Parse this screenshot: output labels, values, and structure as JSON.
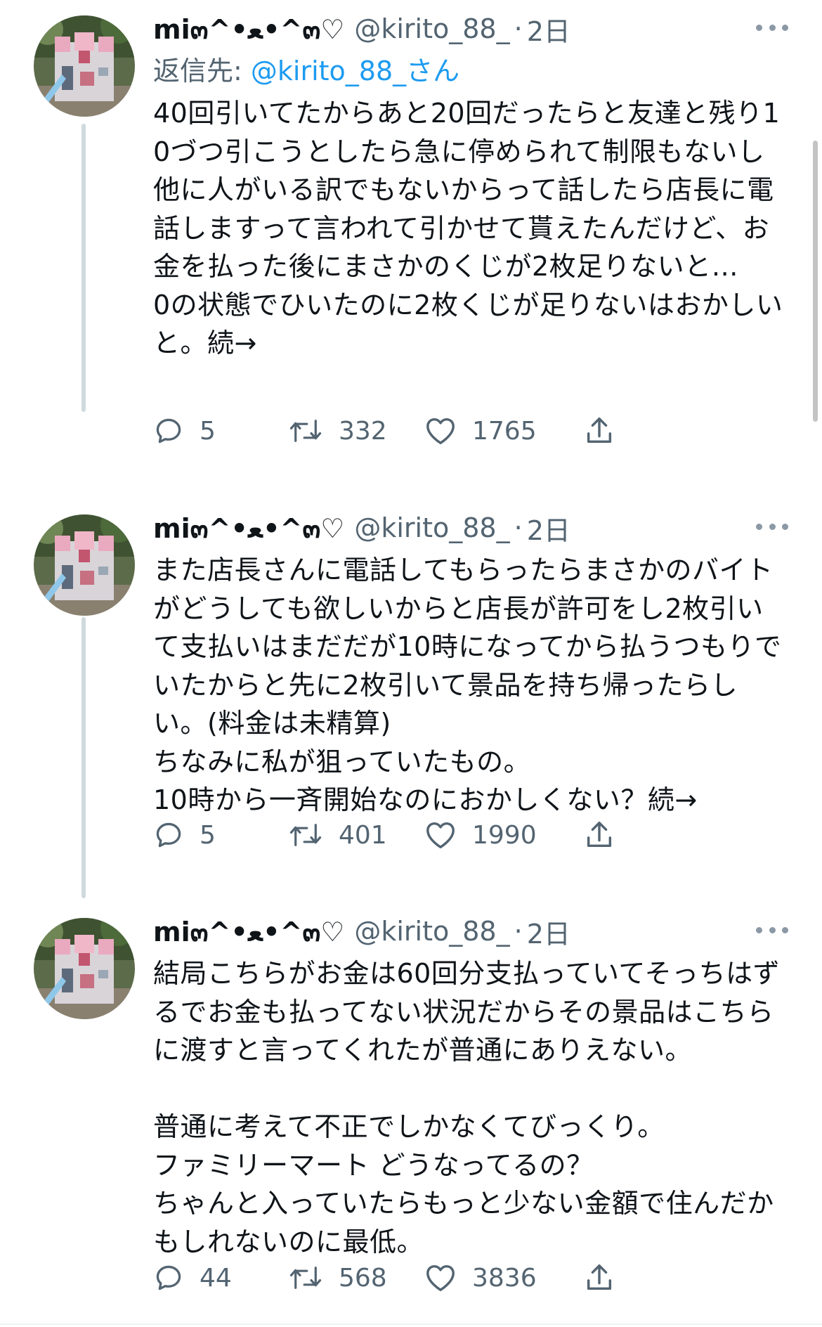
{
  "tweets": [
    {
      "display_name": "mi๓^•ﻌ•^๓♡",
      "handle": "@kirito_88_",
      "separator": "·",
      "time": "2日",
      "reply_to_prefix": "返信先: ",
      "reply_to_handle": "@kirito_88_さん",
      "text": "40回引いてたからあと20回だったらと友達と残り10づつ引こうとしたら急に停められて制限もないし他に人がいる訳でもないからって話したら店長に電話しますって言われて引かせて貰えたんだけど、お金を払った後にまさかのくじが2枚足りないと…\n0の状態でひいたのに2枚くじが足りないはおかしいと。続→",
      "replies": "5",
      "retweets": "332",
      "likes": "1765"
    },
    {
      "display_name": "mi๓^•ﻌ•^๓♡",
      "handle": "@kirito_88_",
      "separator": "·",
      "time": "2日",
      "text": "また店長さんに電話してもらったらまさかのバイトがどうしても欲しいからと店長が許可をし2枚引いて支払いはまだだが10時になってから払うつもりでいたからと先に2枚引いて景品を持ち帰ったらしい。(料金は未精算)\nちなみに私が狙っていたもの。\n10時から一斉開始なのにおかしくない？続→",
      "replies": "5",
      "retweets": "401",
      "likes": "1990"
    },
    {
      "display_name": "mi๓^•ﻌ•^๓♡",
      "handle": "@kirito_88_",
      "separator": "·",
      "time": "2日",
      "text": "結局こちらがお金は60回分支払っていてそっちはずるでお金も払ってない状況だからその景品はこちらに渡すと言ってくれたが普通にありえない。\n\n普通に考えて不正でしかなくてびっくり。\nファミリーマート どうなってるの？\nちゃんと入っていたらもっと少ない金額で住んだかもしれないのに最低。",
      "replies": "44",
      "retweets": "568",
      "likes": "3836"
    }
  ],
  "icons": {
    "avatar": "castle-photo-avatar",
    "reply": "reply-icon",
    "retweet": "retweet-icon",
    "like": "heart-icon",
    "share": "share-icon",
    "more": "more-icon"
  },
  "colors": {
    "text": "#0f1419",
    "secondary": "#536471",
    "link": "#1d9bf0",
    "thread_line": "#cfd9de"
  }
}
